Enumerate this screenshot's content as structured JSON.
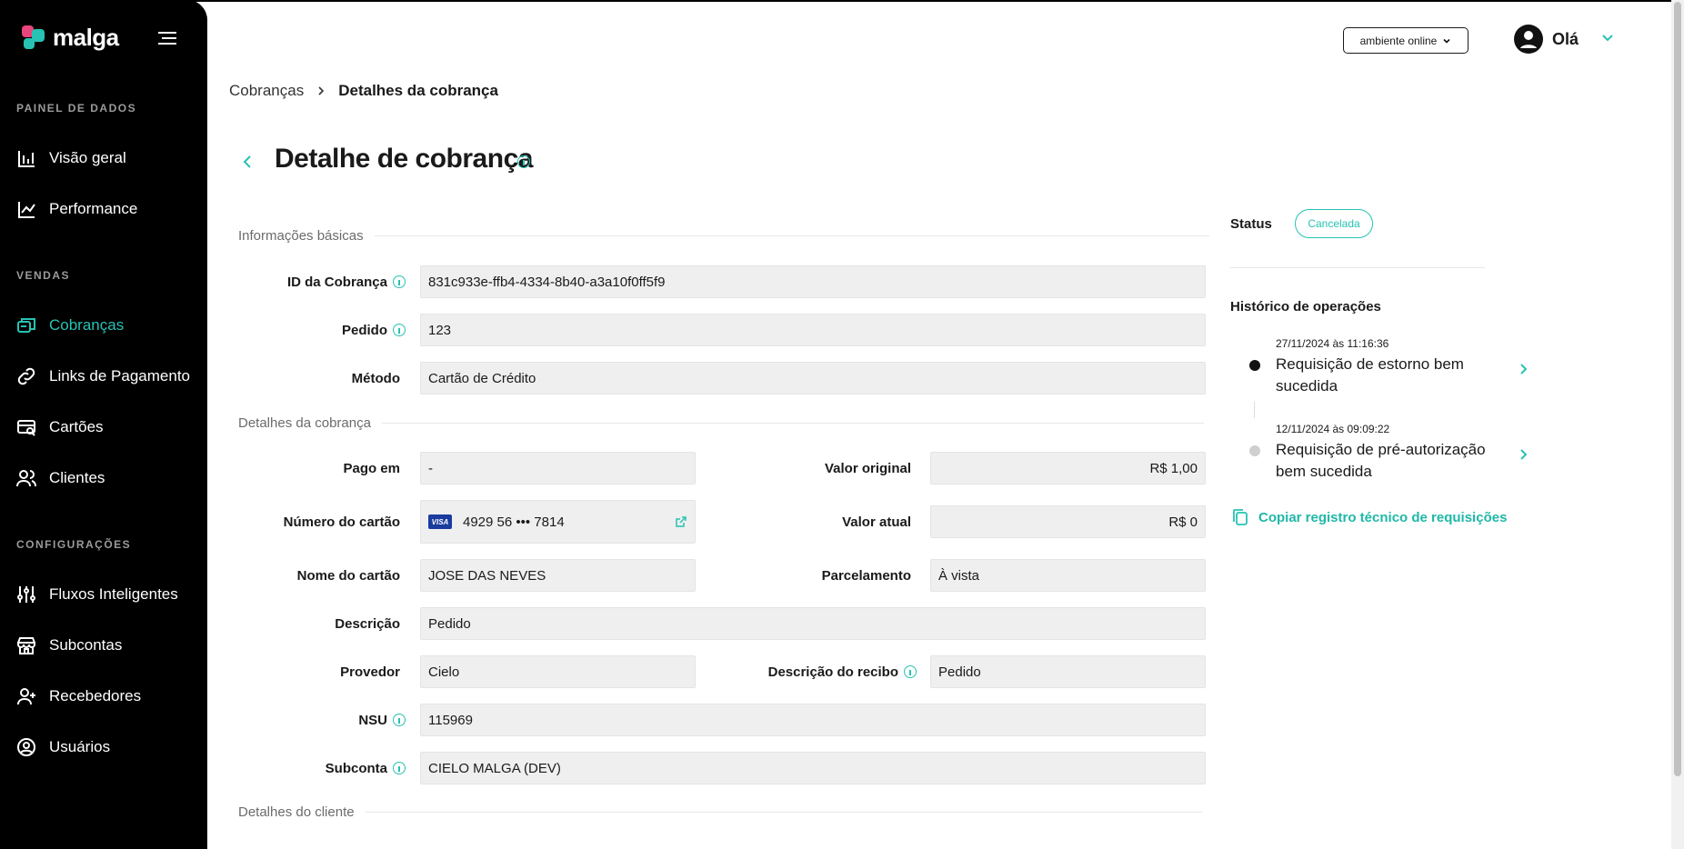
{
  "app": {
    "brand": "malga"
  },
  "sidebar": {
    "sections": [
      {
        "title": "PAINEL DE DADOS",
        "items": [
          {
            "label": "Visão geral",
            "icon": "bar-chart-icon"
          },
          {
            "label": "Performance",
            "icon": "line-chart-icon"
          }
        ]
      },
      {
        "title": "VENDAS",
        "items": [
          {
            "label": "Cobranças",
            "icon": "charges-icon",
            "active": true
          },
          {
            "label": "Links de Pagamento",
            "icon": "link-icon"
          },
          {
            "label": "Cartões",
            "icon": "card-search-icon"
          },
          {
            "label": "Clientes",
            "icon": "users-icon"
          }
        ]
      },
      {
        "title": "CONFIGURAÇÕES",
        "items": [
          {
            "label": "Fluxos Inteligentes",
            "icon": "sliders-icon"
          },
          {
            "label": "Subcontas",
            "icon": "store-icon"
          },
          {
            "label": "Recebedores",
            "icon": "user-plus-icon"
          },
          {
            "label": "Usuários",
            "icon": "user-circle-icon"
          }
        ]
      }
    ]
  },
  "header": {
    "environment": "ambiente online",
    "greeting": "Olá"
  },
  "breadcrumb": {
    "parent": "Cobranças",
    "current": "Detalhes da cobrança"
  },
  "page_title": "Detalhe de cobrança",
  "form": {
    "basic_section": "Informações básicas",
    "charge_id_label": "ID da Cobrança",
    "charge_id": "831c933e-ffb4-4334-8b40-a3a10f0ff5f9",
    "order_label": "Pedido",
    "order": "123",
    "method_label": "Método",
    "method": "Cartão de Crédito",
    "details_section": "Detalhes da cobrança",
    "paid_at_label": "Pago em",
    "paid_at": "-",
    "original_value_label": "Valor original",
    "original_value": "R$ 1,00",
    "card_number_label": "Número do cartão",
    "card_brand": "VISA",
    "card_number": "4929 56 ••• 7814",
    "current_value_label": "Valor atual",
    "current_value": "R$ 0",
    "card_name_label": "Nome do cartão",
    "card_name": "JOSE DAS NEVES",
    "installments_label": "Parcelamento",
    "installments": "À vista",
    "description_label": "Descrição",
    "description": "Pedido",
    "provider_label": "Provedor",
    "provider": "Cielo",
    "receipt_label": "Descrição do recibo",
    "receipt": "Pedido",
    "nsu_label": "NSU",
    "nsu": "115969",
    "subaccount_label": "Subconta",
    "subaccount": "CIELO MALGA (DEV)",
    "customer_section": "Detalhes do cliente"
  },
  "status": {
    "label": "Status",
    "value": "Cancelada",
    "color": "#27c2b3"
  },
  "history": {
    "title": "Histórico de operações",
    "items": [
      {
        "date": "27/11/2024 às 11:16:36",
        "text": "Requisição de estorno bem sucedida",
        "dot": "#111111"
      },
      {
        "date": "12/11/2024 às 09:09:22",
        "text": "Requisição de pré-autorização bem sucedida",
        "dot": "#cfcfcf"
      }
    ],
    "copy_link": "Copiar registro técnico de requisições"
  },
  "colors": {
    "accent": "#27c2b3",
    "sidebar_bg": "#000000",
    "brand_pink": "#e8457c",
    "brand_teal": "#27c2b3"
  }
}
